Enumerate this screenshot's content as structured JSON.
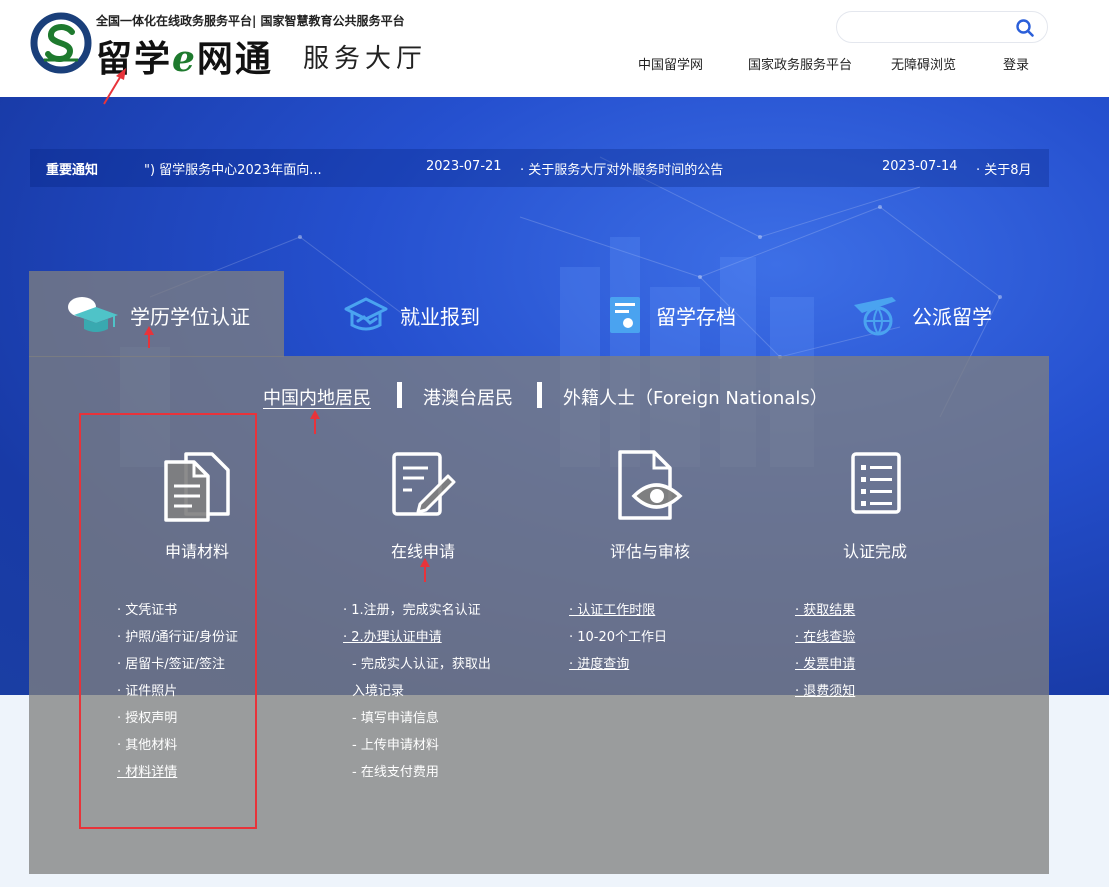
{
  "header": {
    "tagline": "全国一体化在线政务服务平台| 国家智慧教育公共服务平台",
    "brand_main_1": "留学",
    "brand_e": "e",
    "brand_main_2": "网通",
    "brand_sub": "服务大厅",
    "search": {
      "value": "",
      "placeholder": ""
    },
    "nav": [
      "中国留学网",
      "国家政务服务平台",
      "无障碍浏览",
      "登录"
    ]
  },
  "notice": {
    "label": "重要通知",
    "items": [
      {
        "title": "\") 留学服务中心2023年面向...",
        "date": "2023-07-21"
      },
      {
        "title": "· 关于服务大厅对外服务时间的公告",
        "date": "2023-07-14"
      },
      {
        "title": "· 关于8月",
        "date": ""
      }
    ]
  },
  "tabs": [
    {
      "label": "学历学位认证",
      "icon": "graduation-cap-icon",
      "active": true
    },
    {
      "label": "就业报到",
      "icon": "handshake-icon",
      "active": false
    },
    {
      "label": "留学存档",
      "icon": "archive-card-icon",
      "active": false
    },
    {
      "label": "公派留学",
      "icon": "airplane-globe-icon",
      "active": false
    }
  ],
  "subtabs": [
    {
      "label": "中国内地居民",
      "active": true
    },
    {
      "label": "港澳台居民",
      "active": false
    },
    {
      "label": "外籍人士（Foreign Nationals）",
      "active": false
    }
  ],
  "steps": [
    {
      "title": "申请材料",
      "icon": "documents-icon",
      "items": [
        {
          "text": "· 文凭证书",
          "link": false
        },
        {
          "text": "· 护照/通行证/身份证",
          "link": false
        },
        {
          "text": "· 居留卡/签证/签注",
          "link": false
        },
        {
          "text": "· 证件照片",
          "link": false
        },
        {
          "text": "· 授权声明",
          "link": false
        },
        {
          "text": "· 其他材料",
          "link": false
        },
        {
          "text": "· 材料详情",
          "link": true
        }
      ]
    },
    {
      "title": "在线申请",
      "icon": "form-edit-icon",
      "items": [
        {
          "text": "· 1.注册，完成实名认证",
          "link": false
        },
        {
          "text": "· 2.办理认证申请",
          "link": true
        },
        {
          "text": "- 完成实人认证，获取出",
          "link": false
        },
        {
          "text": "入境记录",
          "link": false
        },
        {
          "text": "- 填写申请信息",
          "link": false
        },
        {
          "text": "- 上传申请材料",
          "link": false
        },
        {
          "text": "- 在线支付费用",
          "link": false
        }
      ]
    },
    {
      "title": "评估与审核",
      "icon": "document-eye-icon",
      "items": [
        {
          "text": "· 认证工作时限",
          "link": true
        },
        {
          "text": "· 10-20个工作日",
          "link": false
        },
        {
          "text": "· 进度查询",
          "link": true
        }
      ]
    },
    {
      "title": "认证完成",
      "icon": "checklist-icon",
      "items": [
        {
          "text": "· 获取结果",
          "link": true
        },
        {
          "text": "· 在线查验",
          "link": true
        },
        {
          "text": "· 发票申请",
          "link": true
        },
        {
          "text": "· 退费须知",
          "link": true
        }
      ]
    }
  ],
  "colors": {
    "brand_green": "#1e7a2e",
    "banner_blue": "#2550cf",
    "panel_gray": "#808080",
    "annotation_red": "#e8333a",
    "search_blue": "#2b5fd9"
  }
}
